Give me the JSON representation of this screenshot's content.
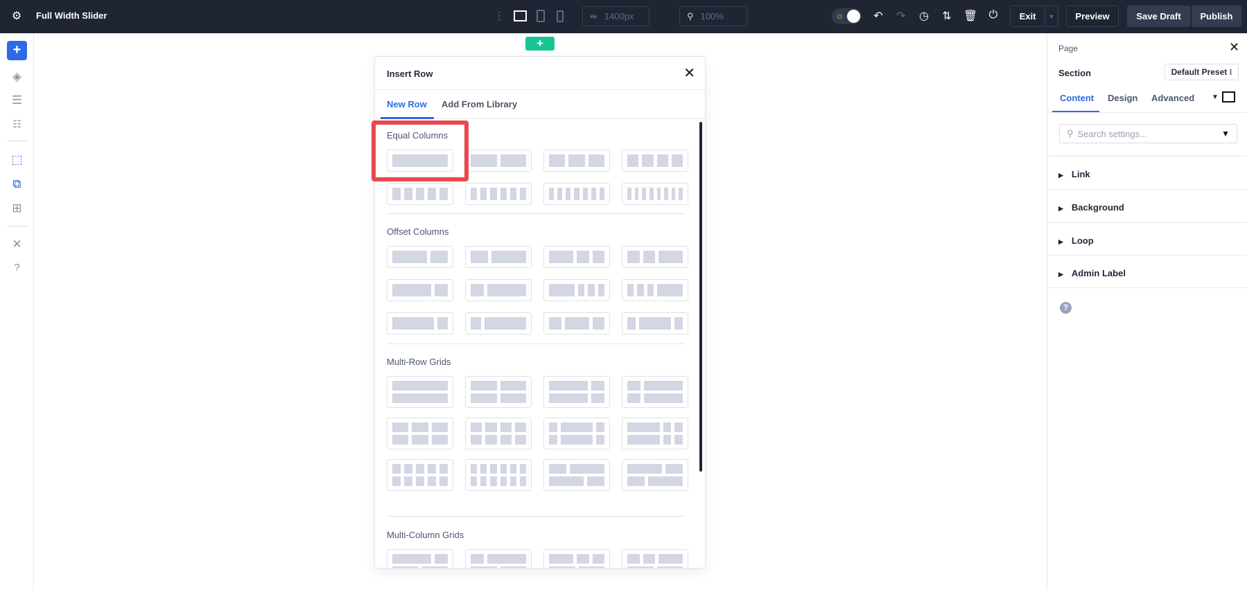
{
  "topbar": {
    "title": "Full Width Slider",
    "width_value": "1400px",
    "zoom_value": "100%",
    "exit_label": "Exit",
    "preview_label": "Preview",
    "save_draft_label": "Save Draft",
    "publish_label": "Publish"
  },
  "dialog": {
    "title": "Insert Row",
    "tabs": [
      {
        "label": "New Row"
      },
      {
        "label": "Add From Library"
      }
    ],
    "groups": [
      {
        "title": "Equal Columns"
      },
      {
        "title": "Offset Columns"
      },
      {
        "title": "Multi-Row Grids"
      },
      {
        "title": "Multi-Column Grids"
      }
    ]
  },
  "panel": {
    "breadcrumb": "Page",
    "title": "Section",
    "preset_label": "Default Preset",
    "tabs": [
      {
        "label": "Content"
      },
      {
        "label": "Design"
      },
      {
        "label": "Advanced"
      }
    ],
    "search_placeholder": "Search settings...",
    "sections": [
      {
        "label": "Link"
      },
      {
        "label": "Background"
      },
      {
        "label": "Loop"
      },
      {
        "label": "Admin Label"
      }
    ]
  },
  "colors": {
    "accent": "#2d6ae3",
    "highlight": "#e9484c",
    "add": "#18c493",
    "topbar": "#1f2533"
  }
}
